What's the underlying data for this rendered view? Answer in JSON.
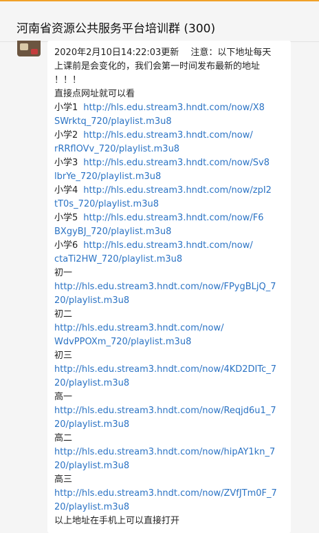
{
  "header": {
    "title": "河南省资源公共服务平台培训群 (300)"
  },
  "message": {
    "notice_lines": [
      "2020年2月10日14:22:03更新　 注意：以下地址每天",
      "上课前是会变化的，我们会第一时间发布最新的地址",
      "！！！",
      "直接点网址就可以看"
    ],
    "entries": [
      {
        "label": "小学1",
        "url_lines": [
          "http://hls.edu.stream3.hndt.com/now/X8",
          "SWrktq_720/playlist.m3u8"
        ]
      },
      {
        "label": "小学2",
        "url_lines": [
          "http://hls.edu.stream3.hndt.com/now/",
          "rRRflOVv_720/playlist.m3u8"
        ]
      },
      {
        "label": "小学3",
        "url_lines": [
          "http://hls.edu.stream3.hndt.com/now/Sv8",
          "lbrYe_720/playlist.m3u8"
        ]
      },
      {
        "label": "小学4",
        "url_lines": [
          "http://hls.edu.stream3.hndt.com/now/zpI2",
          "tT0s_720/playlist.m3u8"
        ]
      },
      {
        "label": "小学5",
        "url_lines": [
          "http://hls.edu.stream3.hndt.com/now/F6",
          "BXgyBJ_720/playlist.m3u8"
        ]
      },
      {
        "label": "小学6",
        "url_lines": [
          "http://hls.edu.stream3.hndt.com/now/",
          "ctaTi2HW_720/playlist.m3u8"
        ]
      },
      {
        "label": "初一",
        "url_lines": [
          "http://hls.edu.stream3.hndt.com/now/FPygBLjQ_7",
          "20/playlist.m3u8"
        ]
      },
      {
        "label": "初二",
        "url_lines": [
          "http://hls.edu.stream3.hndt.com/now/",
          "WdvPPOXm_720/playlist.m3u8"
        ]
      },
      {
        "label": "初三",
        "url_lines": [
          "http://hls.edu.stream3.hndt.com/now/4KD2DITc_7",
          "20/playlist.m3u8"
        ]
      },
      {
        "label": "高一",
        "url_lines": [
          "http://hls.edu.stream3.hndt.com/now/Reqjd6u1_7",
          "20/playlist.m3u8"
        ]
      },
      {
        "label": "高二",
        "url_lines": [
          "http://hls.edu.stream3.hndt.com/now/hipAY1kn_7",
          "20/playlist.m3u8"
        ]
      },
      {
        "label": "高三",
        "url_lines": [
          "http://hls.edu.stream3.hndt.com/now/ZVfJTm0F_7",
          "20/playlist.m3u8"
        ]
      }
    ],
    "footer": "以上地址在手机上可以直接打开"
  },
  "colors": {
    "link": "#2b73c4",
    "accent_bar": "#f0a028",
    "bubble": "#ffffff",
    "background": "#f5f5f5"
  }
}
